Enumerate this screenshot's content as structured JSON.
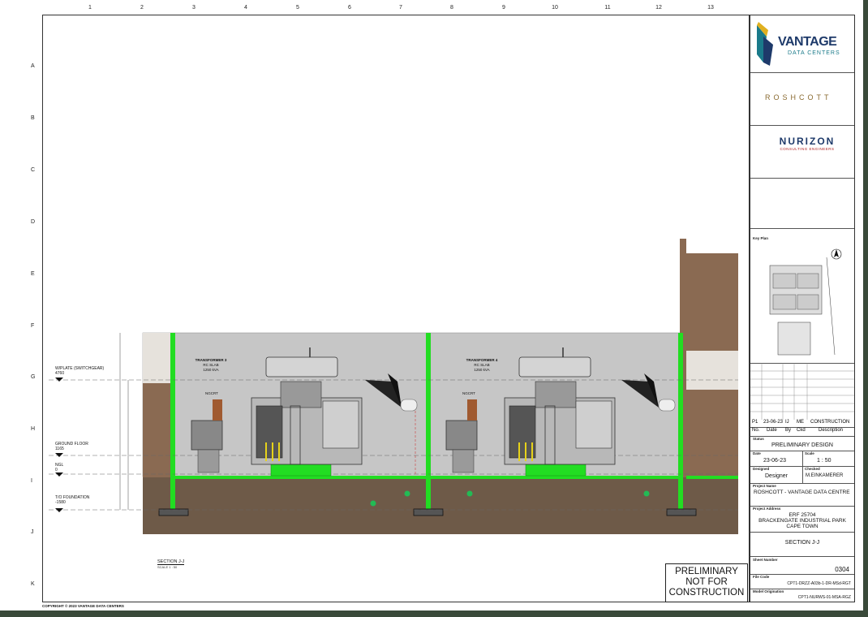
{
  "grid": {
    "columns": [
      "1",
      "2",
      "3",
      "4",
      "5",
      "6",
      "7",
      "8",
      "9",
      "10",
      "11",
      "12",
      "13"
    ],
    "rows": [
      "A",
      "B",
      "C",
      "D",
      "E",
      "F",
      "G",
      "H",
      "I",
      "J",
      "K"
    ]
  },
  "levels": {
    "wplate": {
      "label": "W/PLATE (SWITCHGEAR)",
      "value": "4760"
    },
    "ground": {
      "label": "GROUND FLOOR",
      "value": "1165"
    },
    "ngl": {
      "label": "NGL",
      "value": "0"
    },
    "foundation": {
      "label": "T/O FOUNDATION",
      "value": "-1580"
    }
  },
  "transformers": [
    {
      "title": "TRANSFORMER 3",
      "sub1": "RC SLAB",
      "sub2": "1250 kVA",
      "ngcrt": "NGCRT"
    },
    {
      "title": "TRANSFORMER 4",
      "sub1": "RC SLAB",
      "sub2": "1250 kVA",
      "ngcrt": "NGCRT"
    }
  ],
  "section": {
    "title": "SECTION J-J",
    "scale": "SCALE 1 : 50"
  },
  "copyright": "COPYRIGHT © 2023 VANTAGE DATA CENTERS",
  "stamp": {
    "line1": "PRELIMINARY",
    "line2": "NOT FOR",
    "line3": "CONSTRUCTION"
  },
  "titleblock": {
    "vantage": {
      "name": "VANTAGE",
      "sub": "DATA CENTERS"
    },
    "roshcott": "ROSHCOTT",
    "nurizon": {
      "name": "NURIZON",
      "sub": "CONSULTING ENGINEERS"
    },
    "keyplan_label": "Key Plan",
    "revision": {
      "rev": "P1",
      "date": "23-06-23",
      "by": "IJ",
      "ckd": "ME",
      "desc": "CONSTRUCTION"
    },
    "rev_headers": {
      "no": "No.",
      "date": "Date",
      "by": "By",
      "ckd": "Ckd",
      "desc": "Description"
    },
    "status_label": "Status",
    "status": "PRELIMINARY DESIGN",
    "date_label": "Date",
    "date": "23-06-23",
    "scale_label": "Scale",
    "scale": "1 : 50",
    "designed_label": "Designed",
    "designed": "Designer",
    "checked_label": "Checked",
    "checked": "M.EINKAMERER",
    "project_label": "Project Name",
    "project": "ROSHCOTT - VANTAGE DATA CENTRE",
    "address_label": "Project Address",
    "address1": "ERF 25704",
    "address2": "BRACKENGATE INDUSTRIAL PARK",
    "address3": "CAPE TOWN",
    "drawing_title": "SECTION J-J",
    "sheet_label": "Sheet Number",
    "sheet": "0304",
    "file_label": "File Code",
    "file": "CPT1-DRZZ-A03b-1-DR-MSd-RGT",
    "model_label": "Model Origination",
    "model": "CPT1-NURWS-01-MSA-RGZ"
  },
  "colors": {
    "green": "#22dd22",
    "soil": "#6e5a48",
    "wall": "#c9c9c9",
    "brick": "#8a6a52"
  }
}
